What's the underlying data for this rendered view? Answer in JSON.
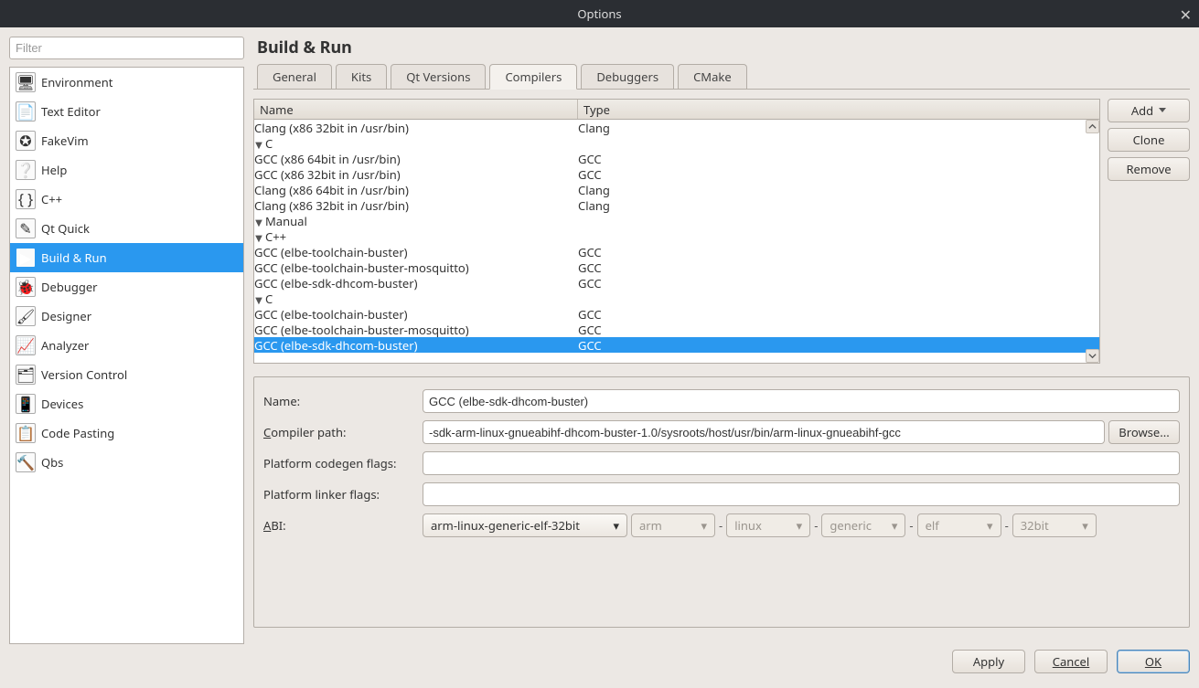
{
  "window": {
    "title": "Options"
  },
  "filter": {
    "placeholder": "Filter"
  },
  "categories": [
    {
      "id": "environment",
      "label": "Environment",
      "selected": false,
      "icon": "🖥"
    },
    {
      "id": "text-editor",
      "label": "Text Editor",
      "selected": false,
      "icon": "📄"
    },
    {
      "id": "fakevim",
      "label": "FakeVim",
      "selected": false,
      "icon": "✪"
    },
    {
      "id": "help",
      "label": "Help",
      "selected": false,
      "icon": "❔"
    },
    {
      "id": "cpp",
      "label": "C++",
      "selected": false,
      "icon": "{ }"
    },
    {
      "id": "qt-quick",
      "label": "Qt Quick",
      "selected": false,
      "icon": "✎"
    },
    {
      "id": "build-run",
      "label": "Build & Run",
      "selected": true,
      "icon": "▶"
    },
    {
      "id": "debugger",
      "label": "Debugger",
      "selected": false,
      "icon": "🐞"
    },
    {
      "id": "designer",
      "label": "Designer",
      "selected": false,
      "icon": "🖌"
    },
    {
      "id": "analyzer",
      "label": "Analyzer",
      "selected": false,
      "icon": "📈"
    },
    {
      "id": "version-control",
      "label": "Version Control",
      "selected": false,
      "icon": "🗂"
    },
    {
      "id": "devices",
      "label": "Devices",
      "selected": false,
      "icon": "📱"
    },
    {
      "id": "code-pasting",
      "label": "Code Pasting",
      "selected": false,
      "icon": "📋"
    },
    {
      "id": "qbs",
      "label": "Qbs",
      "selected": false,
      "icon": "🔨"
    }
  ],
  "page_header": "Build & Run",
  "tabs": {
    "items": [
      "General",
      "Kits",
      "Qt Versions",
      "Compilers",
      "Debuggers",
      "CMake"
    ],
    "active_index": 3
  },
  "tree": {
    "header": {
      "name": "Name",
      "type": "Type"
    },
    "rows": [
      {
        "indent": 3,
        "name": "Clang (x86 32bit in /usr/bin)",
        "type": "Clang",
        "arrow": "",
        "selected": false
      },
      {
        "indent": 2,
        "name": "C",
        "type": "",
        "arrow": "▼",
        "selected": false
      },
      {
        "indent": 3,
        "name": "GCC (x86 64bit in /usr/bin)",
        "type": "GCC",
        "arrow": "",
        "selected": false
      },
      {
        "indent": 3,
        "name": "GCC (x86 32bit in /usr/bin)",
        "type": "GCC",
        "arrow": "",
        "selected": false
      },
      {
        "indent": 3,
        "name": "Clang (x86 64bit in /usr/bin)",
        "type": "Clang",
        "arrow": "",
        "selected": false
      },
      {
        "indent": 3,
        "name": "Clang (x86 32bit in /usr/bin)",
        "type": "Clang",
        "arrow": "",
        "selected": false
      },
      {
        "indent": 1,
        "name": "Manual",
        "type": "",
        "arrow": "▼",
        "selected": false
      },
      {
        "indent": 2,
        "name": "C++",
        "type": "",
        "arrow": "▼",
        "selected": false
      },
      {
        "indent": 3,
        "name": "GCC (elbe-toolchain-buster)",
        "type": "GCC",
        "arrow": "",
        "selected": false
      },
      {
        "indent": 3,
        "name": "GCC (elbe-toolchain-buster-mosquitto)",
        "type": "GCC",
        "arrow": "",
        "selected": false
      },
      {
        "indent": 3,
        "name": "GCC (elbe-sdk-dhcom-buster)",
        "type": "GCC",
        "arrow": "",
        "selected": false
      },
      {
        "indent": 2,
        "name": "C",
        "type": "",
        "arrow": "▼",
        "selected": false
      },
      {
        "indent": 3,
        "name": "GCC (elbe-toolchain-buster)",
        "type": "GCC",
        "arrow": "",
        "selected": false
      },
      {
        "indent": 3,
        "name": "GCC (elbe-toolchain-buster-mosquitto)",
        "type": "GCC",
        "arrow": "",
        "selected": false
      },
      {
        "indent": 3,
        "name": "GCC (elbe-sdk-dhcom-buster)",
        "type": "GCC",
        "arrow": "",
        "selected": true
      }
    ]
  },
  "side_buttons": {
    "add": "Add",
    "clone": "Clone",
    "remove": "Remove"
  },
  "form": {
    "name_label": "Name:",
    "name_value": "GCC (elbe-sdk-dhcom-buster)",
    "path_label_pre": "C",
    "path_label_rest": "ompiler path:",
    "path_value": "-sdk-arm-linux-gnueabihf-dhcom-buster-1.0/sysroots/host/usr/bin/arm-linux-gnueabihf-gcc",
    "browse": "Browse...",
    "codegen_label": "Platform codegen flags:",
    "codegen_value": "",
    "linker_label": "Platform linker flags:",
    "linker_value": "",
    "abi_label_pre": "A",
    "abi_label_rest": "BI:",
    "abi_main": "arm-linux-generic-elf-32bit",
    "abi_parts": [
      "arm",
      "linux",
      "generic",
      "elf",
      "32bit"
    ]
  },
  "bottom": {
    "apply": "Apply",
    "cancel": "Cancel",
    "ok": "OK"
  }
}
